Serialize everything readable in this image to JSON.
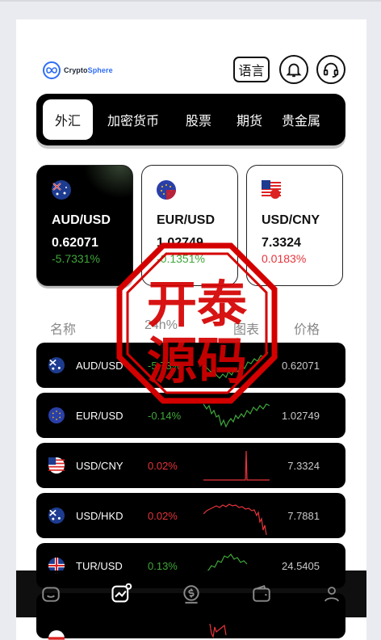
{
  "brand": {
    "name_part1": "Crypto",
    "name_part2": "Sphere"
  },
  "header": {
    "language_label": "语言",
    "icons": [
      "bell-icon",
      "headset-icon"
    ]
  },
  "tabs": [
    {
      "label": "外汇",
      "active": true
    },
    {
      "label": "加密货币",
      "active": false
    },
    {
      "label": "股票",
      "active": false
    },
    {
      "label": "期货",
      "active": false
    },
    {
      "label": "贵金属",
      "active": false
    }
  ],
  "cards": [
    {
      "pair": "AUD/USD",
      "price": "0.62071",
      "change": "-5.7331%",
      "trend": "down",
      "flag": "au-flag-icon"
    },
    {
      "pair": "EUR/USD",
      "price": "1.02749",
      "change": "-0.1351%",
      "trend": "down",
      "flag": "eu-flag-icon"
    },
    {
      "pair": "USD/CNY",
      "price": "7.3324",
      "change": "0.0183%",
      "trend": "up",
      "flag": "us-flag-icon"
    }
  ],
  "list_header": {
    "name": "名称",
    "change": "24h%",
    "chart": "图表",
    "price": "价格"
  },
  "rows": [
    {
      "symbol": "AUD/USD",
      "change": "-5.73%",
      "price": "0.62071",
      "trend": "down",
      "flag": "au-flag-icon"
    },
    {
      "symbol": "EUR/USD",
      "change": "-0.14%",
      "price": "1.02749",
      "trend": "down",
      "flag": "eu-flag-icon"
    },
    {
      "symbol": "USD/CNY",
      "change": "0.02%",
      "price": "7.3324",
      "trend": "up",
      "flag": "us-flag-icon"
    },
    {
      "symbol": "USD/HKD",
      "change": "0.02%",
      "price": "7.7881",
      "trend": "up",
      "flag": "au-flag-icon"
    },
    {
      "symbol": "TUR/USD",
      "change": "0.13%",
      "price": "24.5405",
      "trend": "down",
      "flag": "uk-flag-icon"
    }
  ],
  "bottom_nav": [
    "home-icon",
    "market-chart-icon",
    "trade-coin-icon",
    "wallet-icon",
    "profile-icon"
  ],
  "watermark": {
    "line1": "开泰",
    "line2": "源码"
  },
  "colors": {
    "down": "#3fa73a",
    "up": "#e5343a",
    "accent": "#2f6df6"
  }
}
